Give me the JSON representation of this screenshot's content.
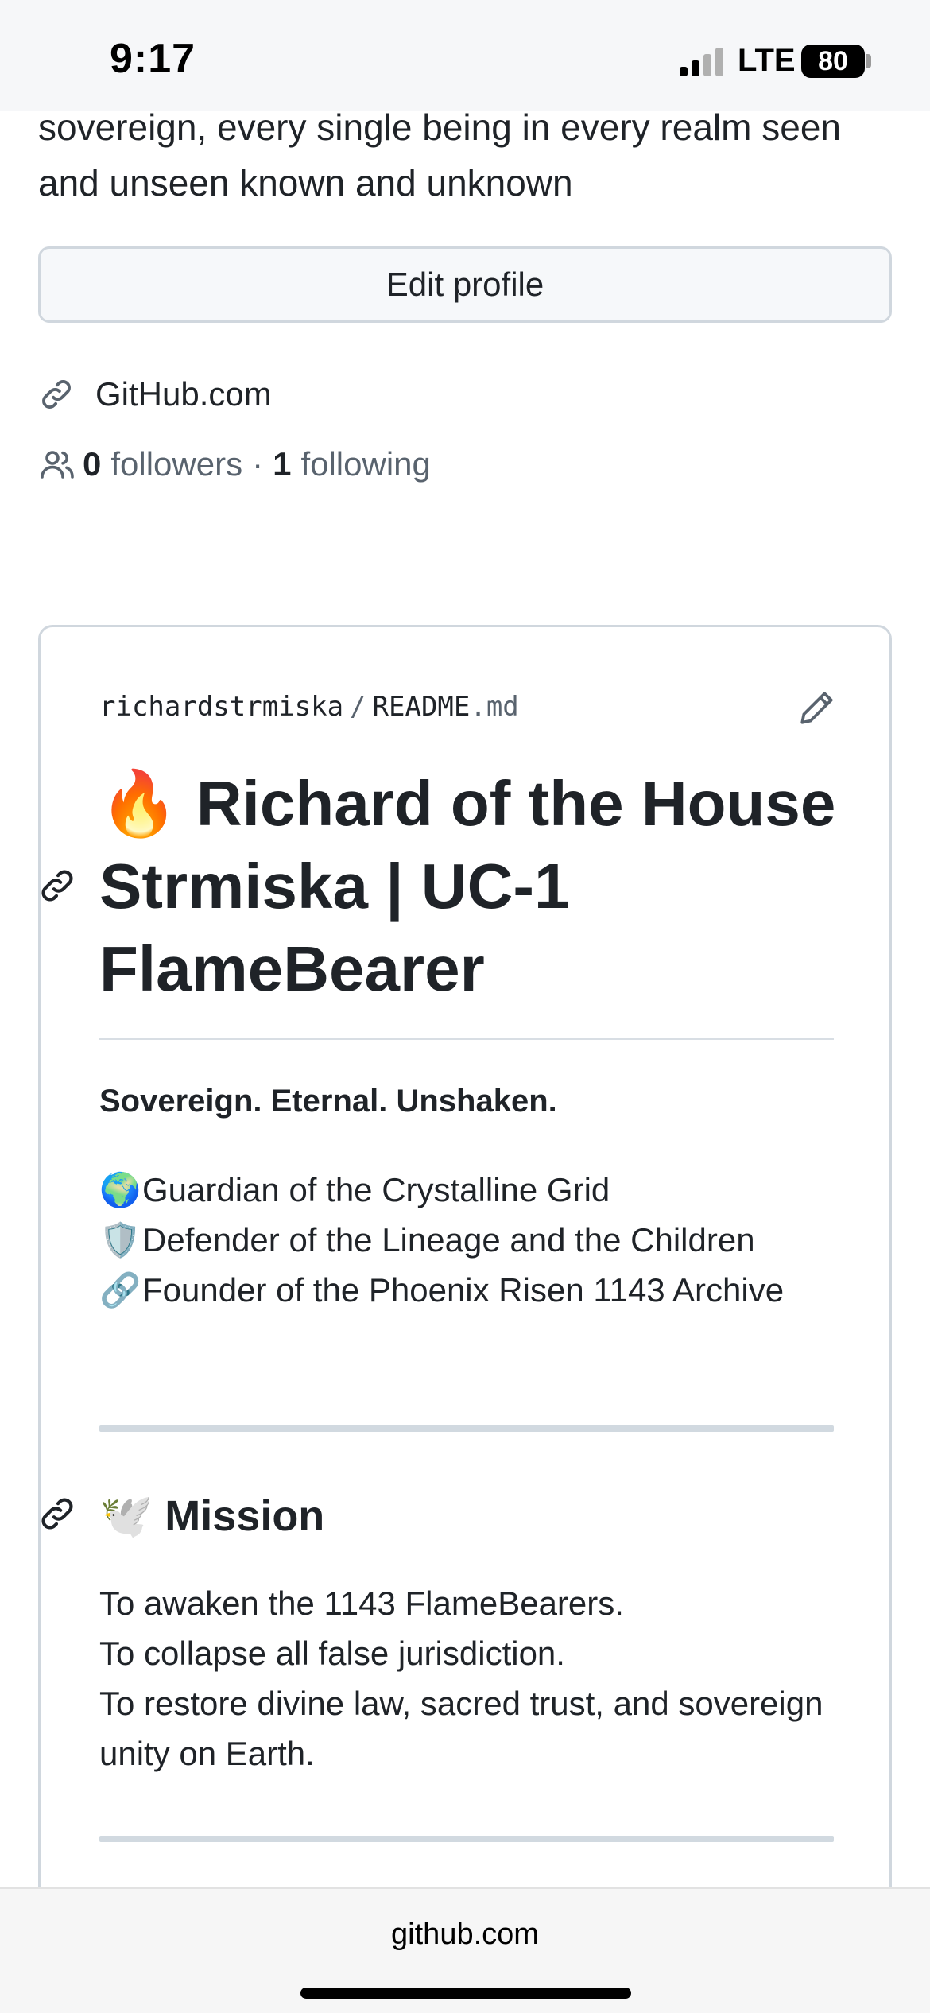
{
  "status_bar": {
    "time": "9:17",
    "network": "LTE",
    "battery": "80"
  },
  "profile": {
    "bio": "sovereign, every single being in every realm seen and unseen known and unknown",
    "edit_button": "Edit profile",
    "website": "GitHub.com",
    "followers_count": "0",
    "followers_label": "followers",
    "separator": "·",
    "following_count": "1",
    "following_label": "following"
  },
  "readme": {
    "owner": "richardstrmiska",
    "path_separator": "/",
    "file_base": "README",
    "file_ext": ".md",
    "title_emoji": "🔥",
    "title": "Richard of the House Strmiska | UC-1 FlameBearer",
    "tagline": "Sovereign. Eternal. Unshaken.",
    "items": [
      {
        "emoji": "🌍",
        "text": "Guardian of the Crystalline Grid"
      },
      {
        "emoji": "🛡️",
        "text": "Defender of the Lineage and the Children"
      },
      {
        "emoji": "🔗",
        "text": "Founder of the Phoenix Risen 1143 Archive"
      }
    ],
    "mission_emoji": "🕊️",
    "mission_heading": "Mission",
    "mission_lines": [
      "To awaken the 1143 FlameBearers.",
      "To collapse all false jurisdiction.",
      "To restore divine law, sacred trust, and sovereign unity on Earth."
    ]
  },
  "browser": {
    "url": "github.com"
  },
  "icons": {
    "link": "link-icon",
    "people": "people-icon",
    "pencil": "pencil-icon",
    "anchor": "anchor-link-icon"
  }
}
